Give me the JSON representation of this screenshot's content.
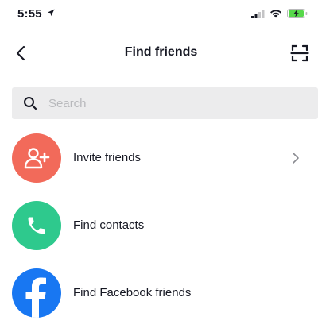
{
  "status_bar": {
    "time": "5:55",
    "battery_color": "#57d84a"
  },
  "nav": {
    "title": "Find friends"
  },
  "search": {
    "placeholder": "Search"
  },
  "items": [
    {
      "label": "Invite friends",
      "icon": "add-user-icon",
      "color": "#f26a5a",
      "has_chevron": true
    },
    {
      "label": "Find contacts",
      "icon": "phone-icon",
      "color": "#2ec98d",
      "has_chevron": false
    },
    {
      "label": "Find Facebook friends",
      "icon": "facebook-icon",
      "color": "#1877f2",
      "has_chevron": false
    }
  ]
}
